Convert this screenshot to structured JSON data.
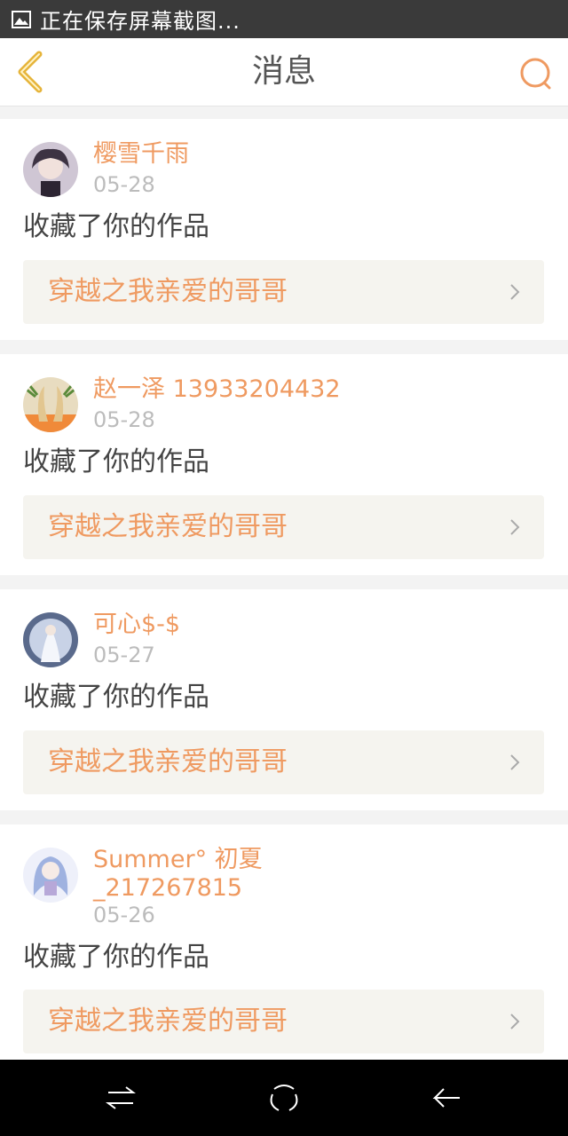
{
  "status_bar": {
    "text": "正在保存屏幕截图...",
    "icon": "image-icon"
  },
  "header": {
    "title": "消息",
    "back_icon": "back-chevron-icon",
    "search_icon": "search-icon"
  },
  "colors": {
    "accent": "#ef9a61",
    "back_chevron": "#e6b43a",
    "work_bg": "#f5f4ef"
  },
  "messages": [
    {
      "user": "樱雪千雨",
      "date": "05-28",
      "action": "收藏了你的作品",
      "work": "穿越之我亲爱的哥哥"
    },
    {
      "user": "赵一泽 13933204432",
      "date": "05-28",
      "action": "收藏了你的作品",
      "work": "穿越之我亲爱的哥哥"
    },
    {
      "user": "可心$-$",
      "date": "05-27",
      "action": "收藏了你的作品",
      "work": "穿越之我亲爱的哥哥"
    },
    {
      "user": "Summer°  初夏\n_217267815",
      "user_line1": "Summer°  初夏",
      "user_line2": "_217267815",
      "date": "05-26",
      "action": "收藏了你的作品",
      "work": "穿越之我亲爱的哥哥"
    }
  ],
  "nav_bar": {
    "icons": [
      "switch-icon",
      "home-icon",
      "back-icon"
    ]
  }
}
